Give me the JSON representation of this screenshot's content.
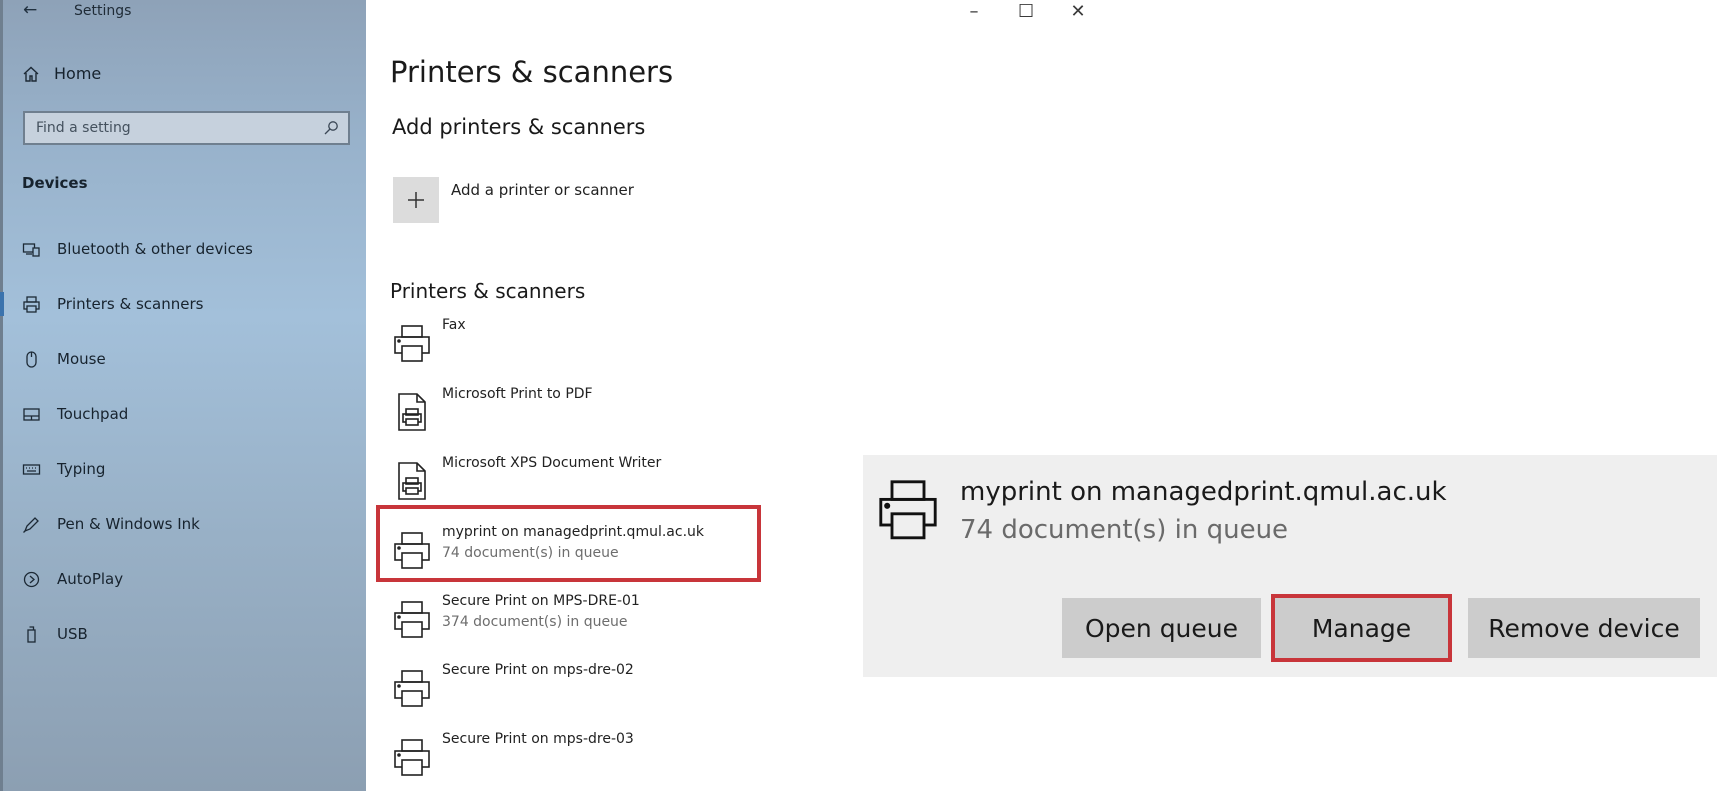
{
  "window": {
    "title": "Settings",
    "back_icon": "back-arrow-icon",
    "controls": [
      "minimize-icon",
      "maximize-icon",
      "close-icon"
    ]
  },
  "sidebar": {
    "home_label": "Home",
    "search_placeholder": "Find a setting",
    "section_heading": "Devices",
    "items": [
      {
        "label": "Bluetooth & other devices",
        "icon": "bluetooth-devices-icon",
        "active": false
      },
      {
        "label": "Printers & scanners",
        "icon": "printer-icon",
        "active": true
      },
      {
        "label": "Mouse",
        "icon": "mouse-icon",
        "active": false
      },
      {
        "label": "Touchpad",
        "icon": "touchpad-icon",
        "active": false
      },
      {
        "label": "Typing",
        "icon": "keyboard-icon",
        "active": false
      },
      {
        "label": "Pen & Windows Ink",
        "icon": "pen-icon",
        "active": false
      },
      {
        "label": "AutoPlay",
        "icon": "autoplay-icon",
        "active": false
      },
      {
        "label": "USB",
        "icon": "usb-icon",
        "active": false
      }
    ]
  },
  "main": {
    "page_title": "Printers & scanners",
    "add_section_heading": "Add printers & scanners",
    "add_button_label": "Add a printer or scanner",
    "list_heading": "Printers & scanners",
    "printers": [
      {
        "name": "Fax",
        "status": "",
        "icon": "printer-icon"
      },
      {
        "name": "Microsoft Print to PDF",
        "status": "",
        "icon": "document-printer-icon"
      },
      {
        "name": "Microsoft XPS Document Writer",
        "status": "",
        "icon": "document-printer-icon"
      },
      {
        "name": "myprint on managedprint.qmul.ac.uk",
        "status": "74 document(s) in queue",
        "icon": "printer-icon",
        "highlighted": true
      },
      {
        "name": "Secure Print on MPS-DRE-01",
        "status": "374 document(s) in queue",
        "icon": "printer-icon"
      },
      {
        "name": "Secure Print on mps-dre-02",
        "status": "",
        "icon": "printer-icon"
      },
      {
        "name": "Secure Print on mps-dre-03",
        "status": "",
        "icon": "printer-icon"
      }
    ]
  },
  "detail": {
    "name": "myprint on managedprint.qmul.ac.uk",
    "status": "74 document(s) in queue",
    "buttons": {
      "open_queue": "Open queue",
      "manage": "Manage",
      "remove_device": "Remove device"
    }
  },
  "colors": {
    "highlight": "#c8353a",
    "active_indicator": "#3b73ad"
  }
}
